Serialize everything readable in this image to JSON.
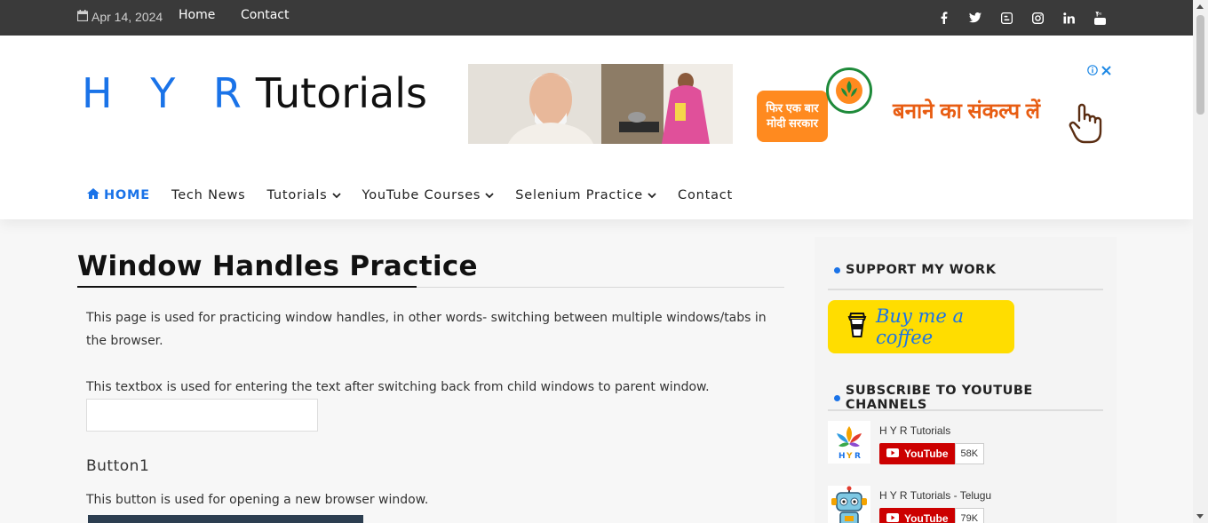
{
  "topbar": {
    "date": "Apr 14, 2024",
    "links": [
      "Home",
      "Contact"
    ],
    "social_icons": [
      "facebook-icon",
      "twitter-icon",
      "blogger-icon",
      "instagram-icon",
      "linkedin-icon",
      "youtube-icon"
    ]
  },
  "logo": {
    "part1": "H Y R",
    "part2": "Tutorials"
  },
  "ad": {
    "badge_line1": "फिर एक बार",
    "badge_line2": "मोदी सरकार",
    "slogan": "बनाने का संकल्प लें"
  },
  "nav": {
    "items": [
      {
        "label": "HOME",
        "dropdown": false,
        "active": true
      },
      {
        "label": "Tech News",
        "dropdown": false
      },
      {
        "label": "Tutorials",
        "dropdown": true
      },
      {
        "label": "YouTube Courses",
        "dropdown": true
      },
      {
        "label": "Selenium Practice",
        "dropdown": true
      },
      {
        "label": "Contact",
        "dropdown": false
      }
    ]
  },
  "main": {
    "title": "Window Handles Practice",
    "intro": "This page is used for practicing window handles, in other words- switching between multiple windows/tabs in the browser.",
    "textbox_desc": "This textbox is used for entering the text after switching back from child windows to parent window.",
    "textbox_value": "",
    "section1_title": "Button1",
    "section1_desc": "This button is used for opening a new browser window."
  },
  "sidebar": {
    "support_title": "SUPPORT MY WORK",
    "coffee_label": "Buy me a coffee",
    "subscribe_title": "SUBSCRIBE TO YOUTUBE CHANNELS",
    "channels": [
      {
        "name": "H Y R Tutorials",
        "button": "YouTube",
        "count": "58K"
      },
      {
        "name": "H Y R Tutorials - Telugu",
        "button": "YouTube",
        "count": "79K"
      }
    ]
  },
  "colors": {
    "accent": "#1a73e8",
    "topbar": "#3a3a3a",
    "coffee": "#ffdd00",
    "youtube": "#cc0000"
  }
}
